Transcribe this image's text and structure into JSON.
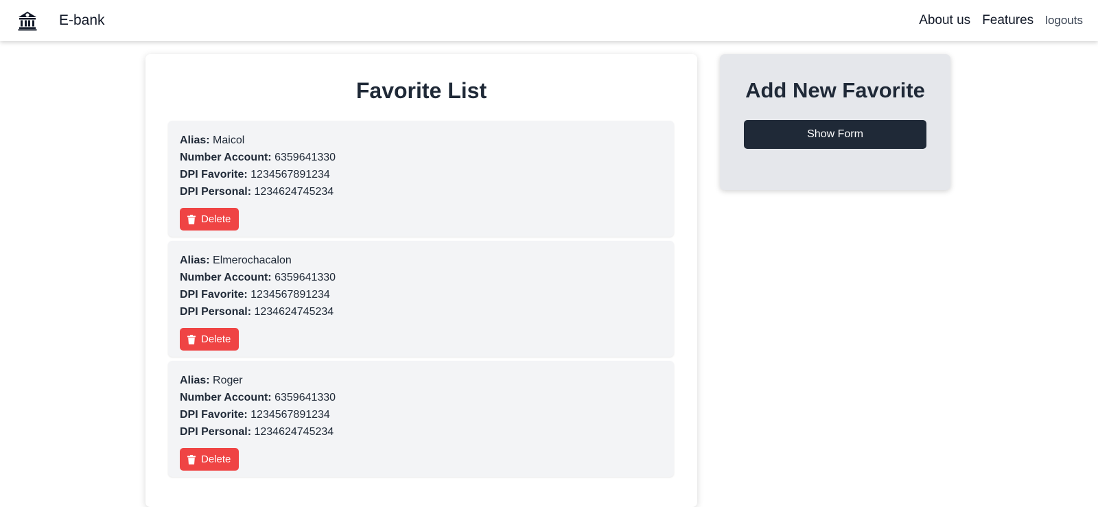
{
  "navbar": {
    "logo_icon": "bank-icon",
    "brand": "E-bank",
    "links": [
      "About us",
      "Features",
      "logouts"
    ]
  },
  "favorites": {
    "title": "Favorite List",
    "field_labels": {
      "alias": "Alias:",
      "account": "Number Account:",
      "dpi_favorite": "DPI Favorite:",
      "dpi_personal": "DPI Personal:"
    },
    "delete_label": "Delete",
    "delete_icon": "trash-icon",
    "items": [
      {
        "alias": "Maicol",
        "account": "6359641330",
        "dpi_favorite": "1234567891234",
        "dpi_personal": "1234624745234"
      },
      {
        "alias": "Elmerochacalon",
        "account": "6359641330",
        "dpi_favorite": "1234567891234",
        "dpi_personal": "1234624745234"
      },
      {
        "alias": "Roger",
        "account": "6359641330",
        "dpi_favorite": "1234567891234",
        "dpi_personal": "1234624745234"
      }
    ]
  },
  "add_favorite": {
    "title": "Add New Favorite",
    "button": "Show Form"
  },
  "colors": {
    "delete": "#ef4444",
    "primary": "#1f2937",
    "item_bg": "#f3f4f6",
    "panel_bg": "#e5e7eb"
  }
}
